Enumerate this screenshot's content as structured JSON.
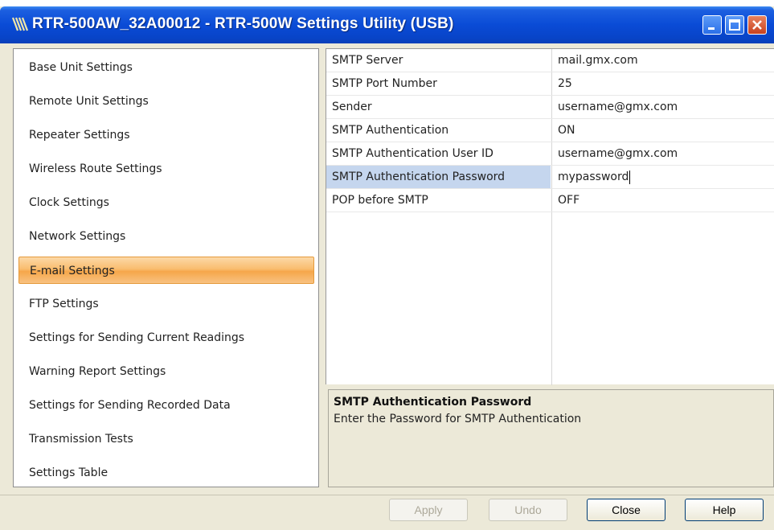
{
  "window": {
    "title": "RTR-500AW_32A00012 - RTR-500W Settings Utility (USB)",
    "icons": [
      "app-icon",
      "minimize-icon",
      "maximize-icon",
      "close-icon"
    ]
  },
  "sidebar": {
    "items": [
      {
        "label": "Base Unit Settings"
      },
      {
        "label": "Remote Unit Settings"
      },
      {
        "label": "Repeater Settings"
      },
      {
        "label": "Wireless Route Settings"
      },
      {
        "label": "Clock Settings"
      },
      {
        "label": "Network Settings"
      },
      {
        "label": "E-mail Settings",
        "active": true
      },
      {
        "label": "FTP Settings"
      },
      {
        "label": "Settings for Sending Current Readings"
      },
      {
        "label": "Warning Report Settings"
      },
      {
        "label": "Settings for Sending Recorded Data"
      },
      {
        "label": "Transmission Tests"
      },
      {
        "label": "Settings Table"
      }
    ]
  },
  "grid": {
    "rows": [
      {
        "name": "SMTP Server",
        "value": "mail.gmx.com"
      },
      {
        "name": "SMTP Port Number",
        "value": "25"
      },
      {
        "name": "Sender",
        "value": "username@gmx.com"
      },
      {
        "name": "SMTP Authentication",
        "value": "ON"
      },
      {
        "name": "SMTP Authentication User ID",
        "value": "username@gmx.com"
      },
      {
        "name": "SMTP Authentication Password",
        "value": "mypassword",
        "selected": true
      },
      {
        "name": "POP before SMTP",
        "value": "OFF"
      }
    ]
  },
  "description": {
    "title": "SMTP Authentication Password",
    "text": "Enter the Password for SMTP Authentication"
  },
  "buttons": {
    "apply": "Apply",
    "undo": "Undo",
    "close": "Close",
    "help": "Help"
  },
  "colors": {
    "titlebar": "#0a4bd6",
    "active_item": "#f9bd6f",
    "selected_row": "#c5d6ee",
    "close_button": "#c8421f"
  }
}
